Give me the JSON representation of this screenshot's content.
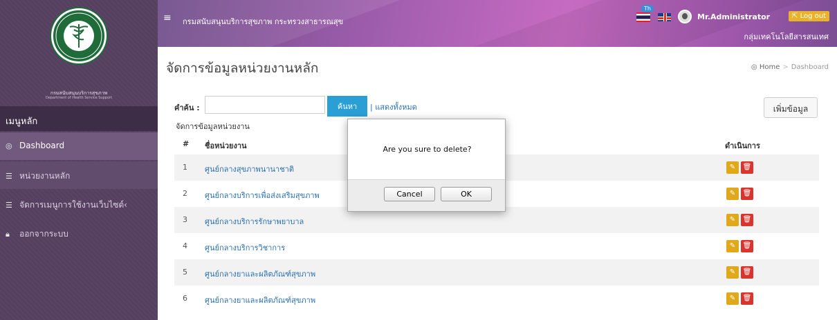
{
  "sidebar": {
    "dept_th": "กรมสนับสนุนบริการสุขภาพ",
    "dept_en": "Department of Health Service Support",
    "menu_heading": "เมนูหลัก",
    "items": [
      {
        "label": "Dashboard",
        "icon": "dashboard-icon"
      },
      {
        "label": "หน่วยงานหลัก",
        "icon": "list-icon"
      },
      {
        "label": "จัดการเมนูการใช้งานเว็บไซต์‹",
        "icon": "list-icon"
      },
      {
        "label": "ออกจากระบบ",
        "icon": "lock-icon"
      }
    ]
  },
  "header": {
    "title": "กรมสนับสนุนบริการสุขภาพ กระทรวงสาธารณสุข",
    "lang_badge": "Th",
    "username": "Mr.Administrator",
    "logout_label": "Log out",
    "group": "กลุ่มเทคโนโลยีสารสนเทศ"
  },
  "page": {
    "title": "จัดการข้อมูลหน่วยงานหลัก",
    "breadcrumb": {
      "home": "Home",
      "current": "Dashboard"
    }
  },
  "search": {
    "label": "คำค้น :",
    "value": "",
    "button": "ค้นหา",
    "show_all": "| แสดงทั้งหมด"
  },
  "add_button": "เพิ่มข้อมูล",
  "table": {
    "caption": "จัดการข้อมูลหน่วยงาน",
    "headers": {
      "no": "#",
      "name": "ชื่อหน่วยงาน",
      "action": "ดำเนินการ"
    },
    "rows": [
      {
        "no": "1",
        "name": "ศูนย์กลางสุขภาพนานาชาติ"
      },
      {
        "no": "2",
        "name": "ศูนย์กลางบริการเพื่อส่งเสริมสุขภาพ"
      },
      {
        "no": "3",
        "name": "ศูนย์กลางบริการรักษาพยาบาล"
      },
      {
        "no": "4",
        "name": "ศูนย์กลางบริการวิชาการ"
      },
      {
        "no": "5",
        "name": "ศูนย์กลางยาและผลิตภัณฑ์สุขภาพ"
      },
      {
        "no": "6",
        "name": "ศูนย์กลางยาและผลิตภัณฑ์สุขภาพ"
      }
    ]
  },
  "dialog": {
    "message": "Are you sure to delete?",
    "cancel": "Cancel",
    "ok": "OK"
  },
  "colors": {
    "sidebar": "#55405f",
    "accent": "#2a9fd6",
    "edit": "#e0a91c",
    "delete": "#d9342e"
  }
}
